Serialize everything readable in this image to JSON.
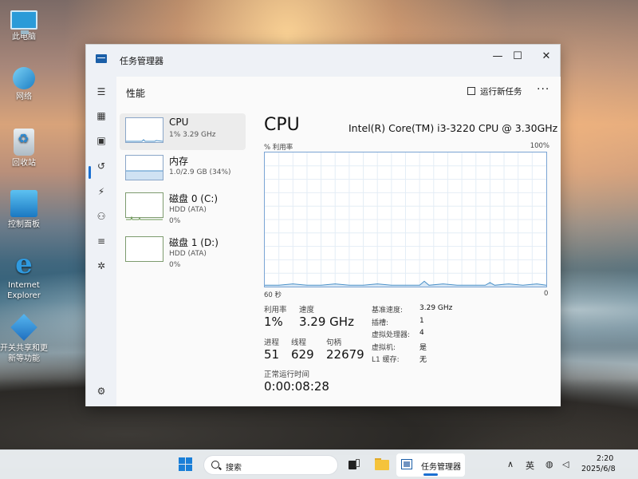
{
  "desktop": {
    "icons": [
      {
        "label": "此电脑"
      },
      {
        "label": "网络"
      },
      {
        "label": "回收站"
      },
      {
        "label": "控制面板"
      },
      {
        "label": "Internet Explorer"
      },
      {
        "label": "开关共享和更新等功能"
      }
    ]
  },
  "window": {
    "title": "任务管理器",
    "controls": {
      "minimize": "—",
      "maximize": "☐",
      "close": "✕"
    }
  },
  "header": {
    "title": "性能",
    "run_new_task": "运行新任务",
    "more": "···"
  },
  "resources": [
    {
      "name": "CPU",
      "sub1": "1%  3.29 GHz",
      "sub2": ""
    },
    {
      "name": "内存",
      "sub1": "1.0/2.9 GB (34%)",
      "sub2": ""
    },
    {
      "name": "磁盘 0 (C:)",
      "sub1": "HDD (ATA)",
      "sub2": "0%"
    },
    {
      "name": "磁盘 1 (D:)",
      "sub1": "HDD (ATA)",
      "sub2": "0%"
    }
  ],
  "detail": {
    "title": "CPU",
    "model": "Intel(R) Core(TM) i3-3220 CPU @ 3.30GHz",
    "graph_label_left": "% 利用率",
    "graph_label_right": "100%",
    "graph_time_left": "60 秒",
    "graph_time_right": "0",
    "utilization_label": "利用率",
    "utilization": "1%",
    "speed_label": "速度",
    "speed": "3.29 GHz",
    "processes_label": "进程",
    "processes": "51",
    "threads_label": "线程",
    "threads": "629",
    "handles_label": "句柄",
    "handles": "22679",
    "uptime_label": "正常运行时间",
    "uptime": "0:00:08:28",
    "specs": [
      {
        "k": "基准速度:",
        "v": "3.29 GHz"
      },
      {
        "k": "插槽:",
        "v": "1"
      },
      {
        "k": "虚拟处理器:",
        "v": "4"
      },
      {
        "k": "虚拟机:",
        "v": "是"
      },
      {
        "k": "L1 缓存:",
        "v": "无"
      }
    ]
  },
  "taskbar": {
    "search_placeholder": "搜索",
    "active_app": "任务管理器",
    "ime": "英",
    "time": "2:20",
    "date": "2025/6/8"
  },
  "chart_data": {
    "type": "line",
    "title": "CPU",
    "xlabel": "60 秒",
    "ylabel": "% 利用率",
    "ylim": [
      0,
      100
    ],
    "xlim": [
      60,
      0
    ],
    "x": [
      60,
      57,
      54,
      51,
      48,
      45,
      42,
      39,
      36,
      33,
      30,
      27,
      26,
      25,
      22,
      19,
      16,
      13,
      12,
      11,
      8,
      5,
      2,
      0
    ],
    "series": [
      {
        "values": [
          1,
          1,
          2,
          1,
          1,
          2,
          1,
          1,
          2,
          1,
          1,
          1,
          4,
          1,
          2,
          1,
          1,
          1,
          3,
          1,
          2,
          1,
          2,
          1
        ]
      }
    ],
    "grid": true
  },
  "colors": {
    "accent": "#1a6fd1",
    "graph_border": "#7aa4d4",
    "graph_line": "#4a90c8",
    "graph_fill": "#cfe2f3"
  }
}
